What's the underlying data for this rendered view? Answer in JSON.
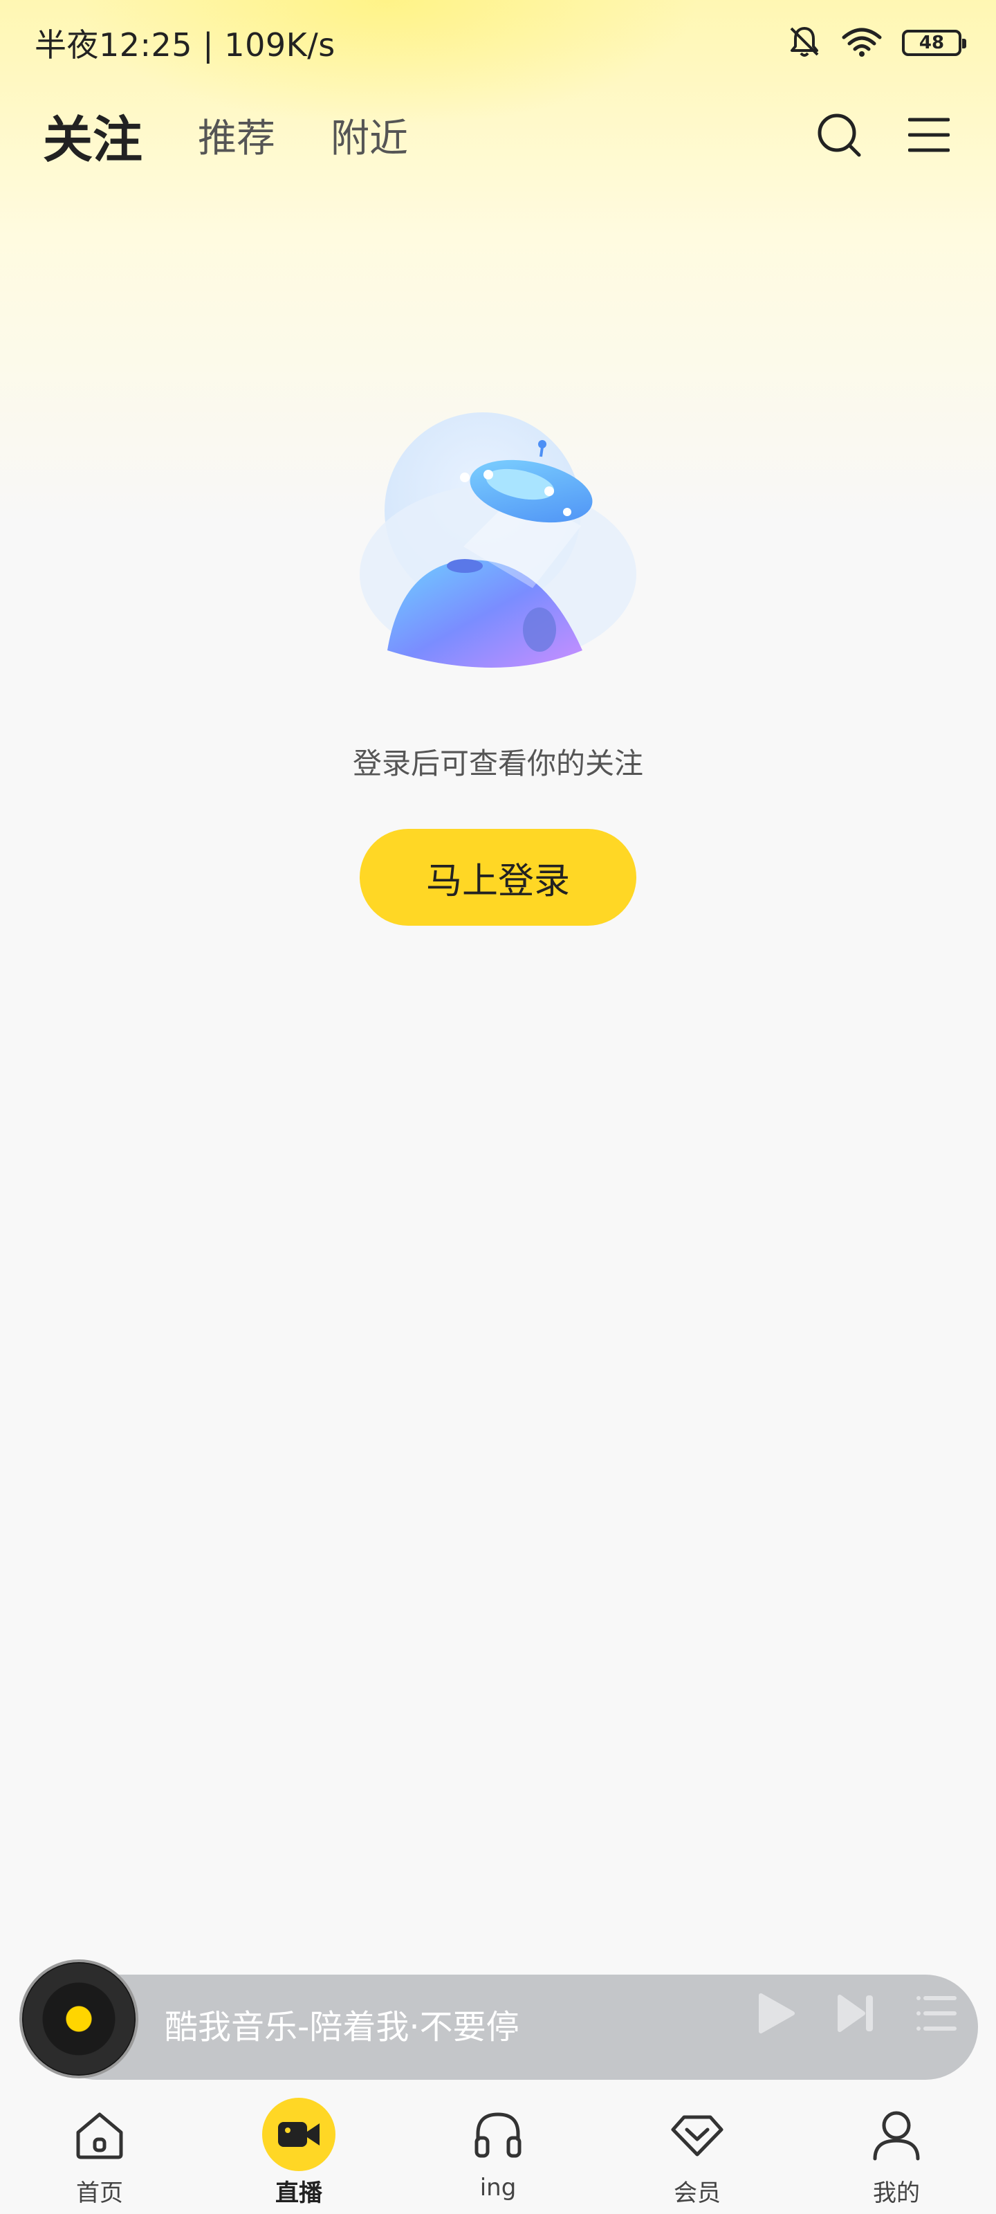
{
  "status_bar": {
    "time_text": "半夜12:25 | 109K/s",
    "battery_level": "48"
  },
  "top_nav": {
    "tabs": [
      {
        "label": "关注",
        "active": true
      },
      {
        "label": "推荐",
        "active": false
      },
      {
        "label": "附近",
        "active": false
      }
    ],
    "icons": [
      "search-icon",
      "menu-icon"
    ]
  },
  "empty_state": {
    "message": "登录后可查看你的关注",
    "login_button": "马上登录"
  },
  "player": {
    "title": "酷我音乐-陪着我·不要停",
    "icons": [
      "play-icon",
      "next-icon",
      "playlist-icon"
    ]
  },
  "bottom_nav": {
    "items": [
      {
        "label": "首页",
        "icon": "home-icon",
        "active": false
      },
      {
        "label": "直播",
        "icon": "video-camera-icon",
        "active": true
      },
      {
        "label": "ing",
        "icon": "headphones-icon",
        "active": false
      },
      {
        "label": "会员",
        "icon": "diamond-icon",
        "active": false
      },
      {
        "label": "我的",
        "icon": "user-icon",
        "active": false
      }
    ]
  },
  "colors": {
    "accent": "#ffd725",
    "player_bar": "#c4c6c9",
    "background": "#f8f8f8"
  }
}
